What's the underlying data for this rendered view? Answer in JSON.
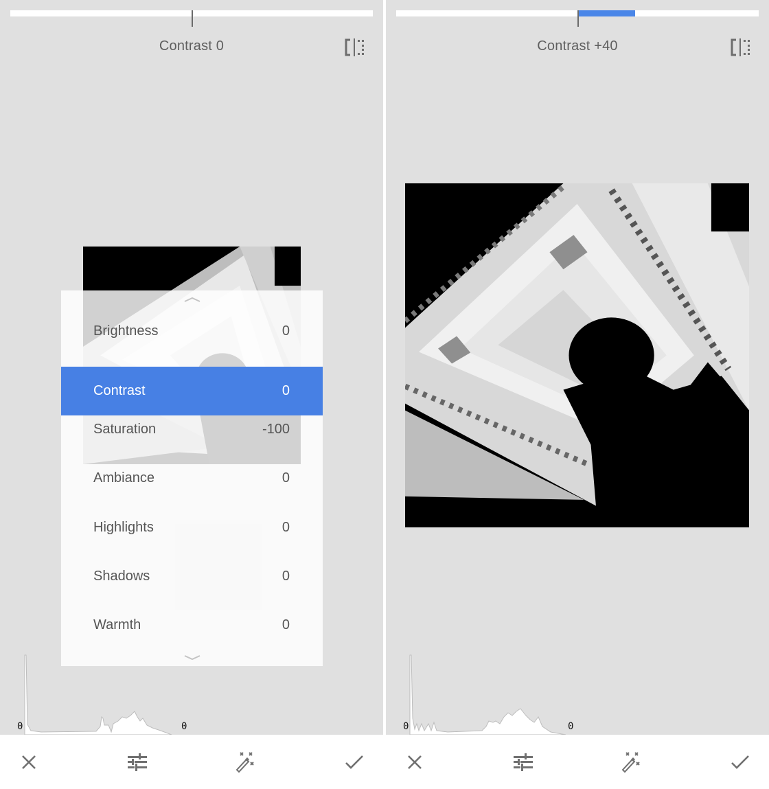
{
  "colors": {
    "accent": "#4780e4",
    "background": "#e0e0e0",
    "toolbar": "#ffffff",
    "icon": "#707070"
  },
  "panels": [
    {
      "id": "before",
      "slider": {
        "label": "Contrast",
        "value": 0,
        "min": -100,
        "max": 100
      },
      "title": "Contrast 0",
      "compare_icon": "compare-split-icon",
      "menu": {
        "visible": true,
        "scroll_up_icon": "chevron-up-icon",
        "scroll_down_icon": "chevron-down-icon",
        "items": [
          {
            "label": "Brightness",
            "value": "0",
            "selected": false
          },
          {
            "label": "Contrast",
            "value": "0",
            "selected": true
          },
          {
            "label": "Saturation",
            "value": "-100",
            "selected": false
          },
          {
            "label": "Ambiance",
            "value": "0",
            "selected": false
          },
          {
            "label": "Highlights",
            "value": "0",
            "selected": false
          },
          {
            "label": "Shadows",
            "value": "0",
            "selected": false
          },
          {
            "label": "Warmth",
            "value": "0",
            "selected": false
          }
        ]
      },
      "histogram": {
        "left_label": "0",
        "right_label": "0"
      },
      "toolbar": {
        "cancel_icon": "close-icon",
        "adjust_icon": "tune-sliders-icon",
        "auto_icon": "magic-wand-icon",
        "apply_icon": "checkmark-icon"
      }
    },
    {
      "id": "after",
      "slider": {
        "label": "Contrast",
        "value": 40,
        "min": -100,
        "max": 100
      },
      "title": "Contrast +40",
      "compare_icon": "compare-split-icon",
      "menu": {
        "visible": false
      },
      "histogram": {
        "left_label": "0",
        "right_label": "0"
      },
      "toolbar": {
        "cancel_icon": "close-icon",
        "adjust_icon": "tune-sliders-icon",
        "auto_icon": "magic-wand-icon",
        "apply_icon": "checkmark-icon"
      }
    }
  ]
}
